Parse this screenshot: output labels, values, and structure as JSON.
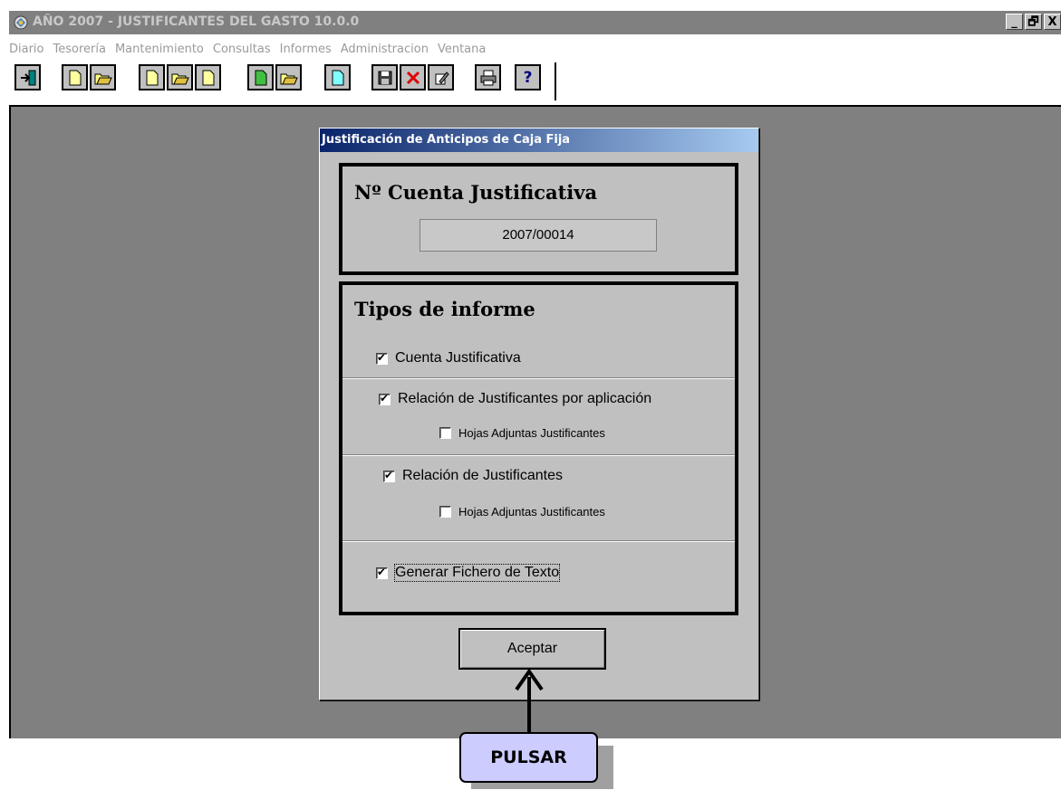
{
  "window": {
    "title": "AÑO 2007 - JUSTIFICANTES DEL GASTO 10.0.0",
    "buttons": [
      "_",
      "🗗",
      "X"
    ]
  },
  "menu": [
    "Diario",
    "Tesorería",
    "Mantenimiento",
    "Consultas",
    "Informes",
    "Administracion",
    "Ventana"
  ],
  "toolbar": {
    "groups": [
      [
        "exit-icon"
      ],
      [
        "new-document-icon",
        "open-folder-icon"
      ],
      [
        "new-document-icon",
        "open-folder-icon",
        "new-document-icon"
      ],
      [
        "new-document-green-icon",
        "open-folder-icon"
      ],
      [
        "new-document-cyan-icon"
      ],
      [
        "save-icon",
        "delete-icon",
        "edit-icon"
      ],
      [
        "print-icon"
      ],
      [
        "help-icon"
      ]
    ],
    "help_label": "?"
  },
  "dialog": {
    "title": "Justificación de Anticipos de Caja Fija",
    "account_group_title": "Nº Cuenta Justificativa",
    "account_number": "2007/00014",
    "report_group_title": "Tipos de informe",
    "options": {
      "cuenta": {
        "label": "Cuenta Justificativa",
        "checked": true
      },
      "relacion_aplicacion": {
        "label": "Relación de Justificantes por aplicación",
        "checked": true
      },
      "hojas_1": {
        "label": "Hojas Adjuntas Justificantes",
        "checked": false
      },
      "relacion": {
        "label": "Relación de Justificantes",
        "checked": true
      },
      "hojas_2": {
        "label": "Hojas Adjuntas Justificantes",
        "checked": false
      },
      "fichero": {
        "label": "Generar Fichero de Texto",
        "checked": true
      }
    },
    "accept_label": "Aceptar"
  },
  "annotation": {
    "label": "PULSAR"
  }
}
